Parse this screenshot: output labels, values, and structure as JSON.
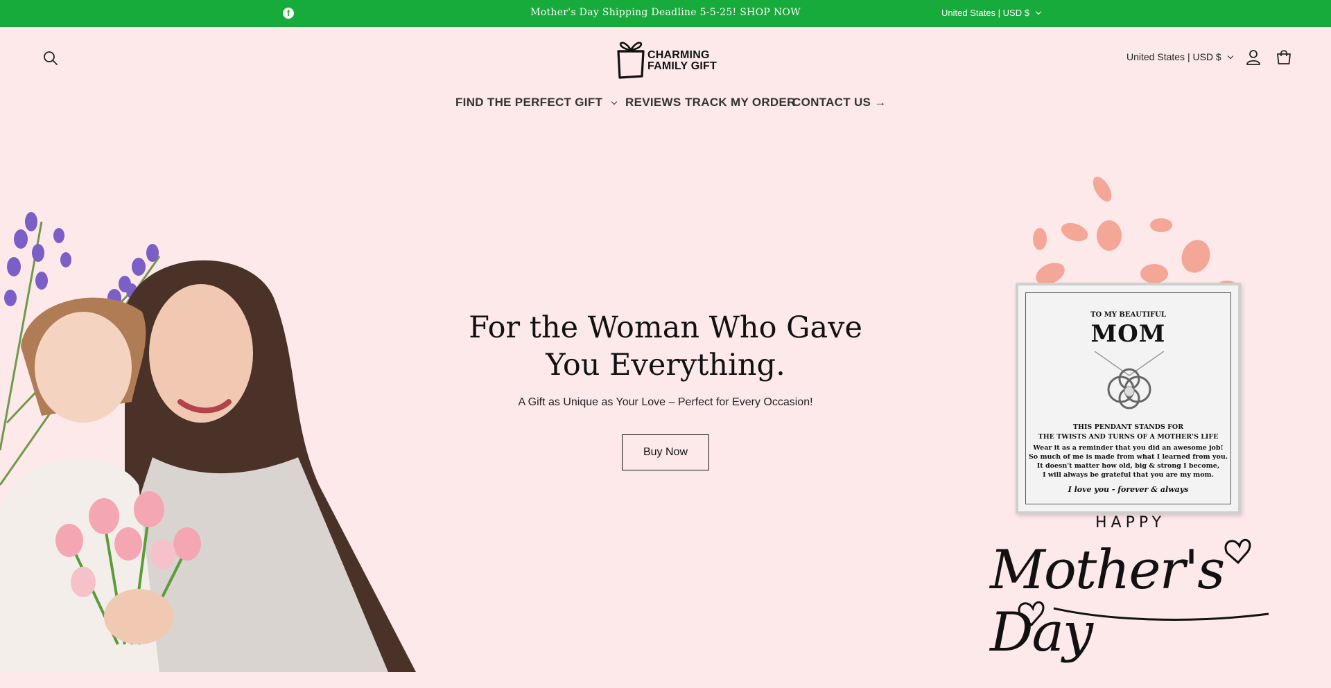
{
  "announcement": {
    "social": "facebook",
    "message": "Mother's Day Shipping Deadline 5-5-25! SHOP NOW",
    "locale": "United States | USD $"
  },
  "header": {
    "brand_line1": "CHARMING",
    "brand_line2": "FAMILY GIFT",
    "locale": "United States | USD $"
  },
  "nav": {
    "items": [
      "FIND THE PERFECT GIFT",
      "REVIEWS",
      "TRACK MY ORDER",
      "CONTACT US →"
    ]
  },
  "hero": {
    "title_line1": "For the Woman Who Gave",
    "title_line2": "You Everything.",
    "subtitle": "A Gift as Unique as Your Love – Perfect for Every Occasion!",
    "cta": "Buy Now"
  },
  "product_card": {
    "to": "TO MY BEAUTIFUL",
    "mom": "MOM",
    "line1": "THIS PENDANT STANDS FOR",
    "line2": "THE TWISTS AND TURNS OF A MOTHER'S LIFE",
    "body": [
      "Wear it as a reminder that you did an awesome job!",
      "So much of me is made from what I learned from you.",
      "It doesn't matter how old, big & strong I become,",
      "I will always be grateful that you are my mom."
    ],
    "sign": "I love you - forever & always"
  },
  "greeting": {
    "happy": "HAPPY",
    "mothers_day": "Mother's Day"
  },
  "colors": {
    "announcement_bg": "#16ab3a",
    "page_bg": "#fde8ea"
  }
}
